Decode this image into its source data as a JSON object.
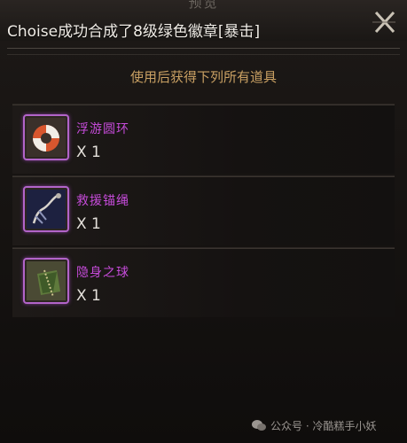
{
  "header": {
    "faded_title": "预览",
    "announcement": "Choise成功合成了8级绿色徽章[暴击]"
  },
  "panel": {
    "subtitle": "使用后获得下列所有道具"
  },
  "items": [
    {
      "name": "浮游圆环",
      "qty": "X 1",
      "icon": "life-ring-icon"
    },
    {
      "name": "救援锚绳",
      "qty": "X 1",
      "icon": "anchor-rope-icon"
    },
    {
      "name": "隐身之球",
      "qty": "X 1",
      "icon": "stealth-orb-icon"
    }
  ],
  "footer": {
    "source": "公众号 · 冷酷糕手小妖"
  },
  "colors": {
    "item_name": "#c54bd9",
    "subtitle": "#c9a063",
    "slot_border": "#b264c9"
  }
}
